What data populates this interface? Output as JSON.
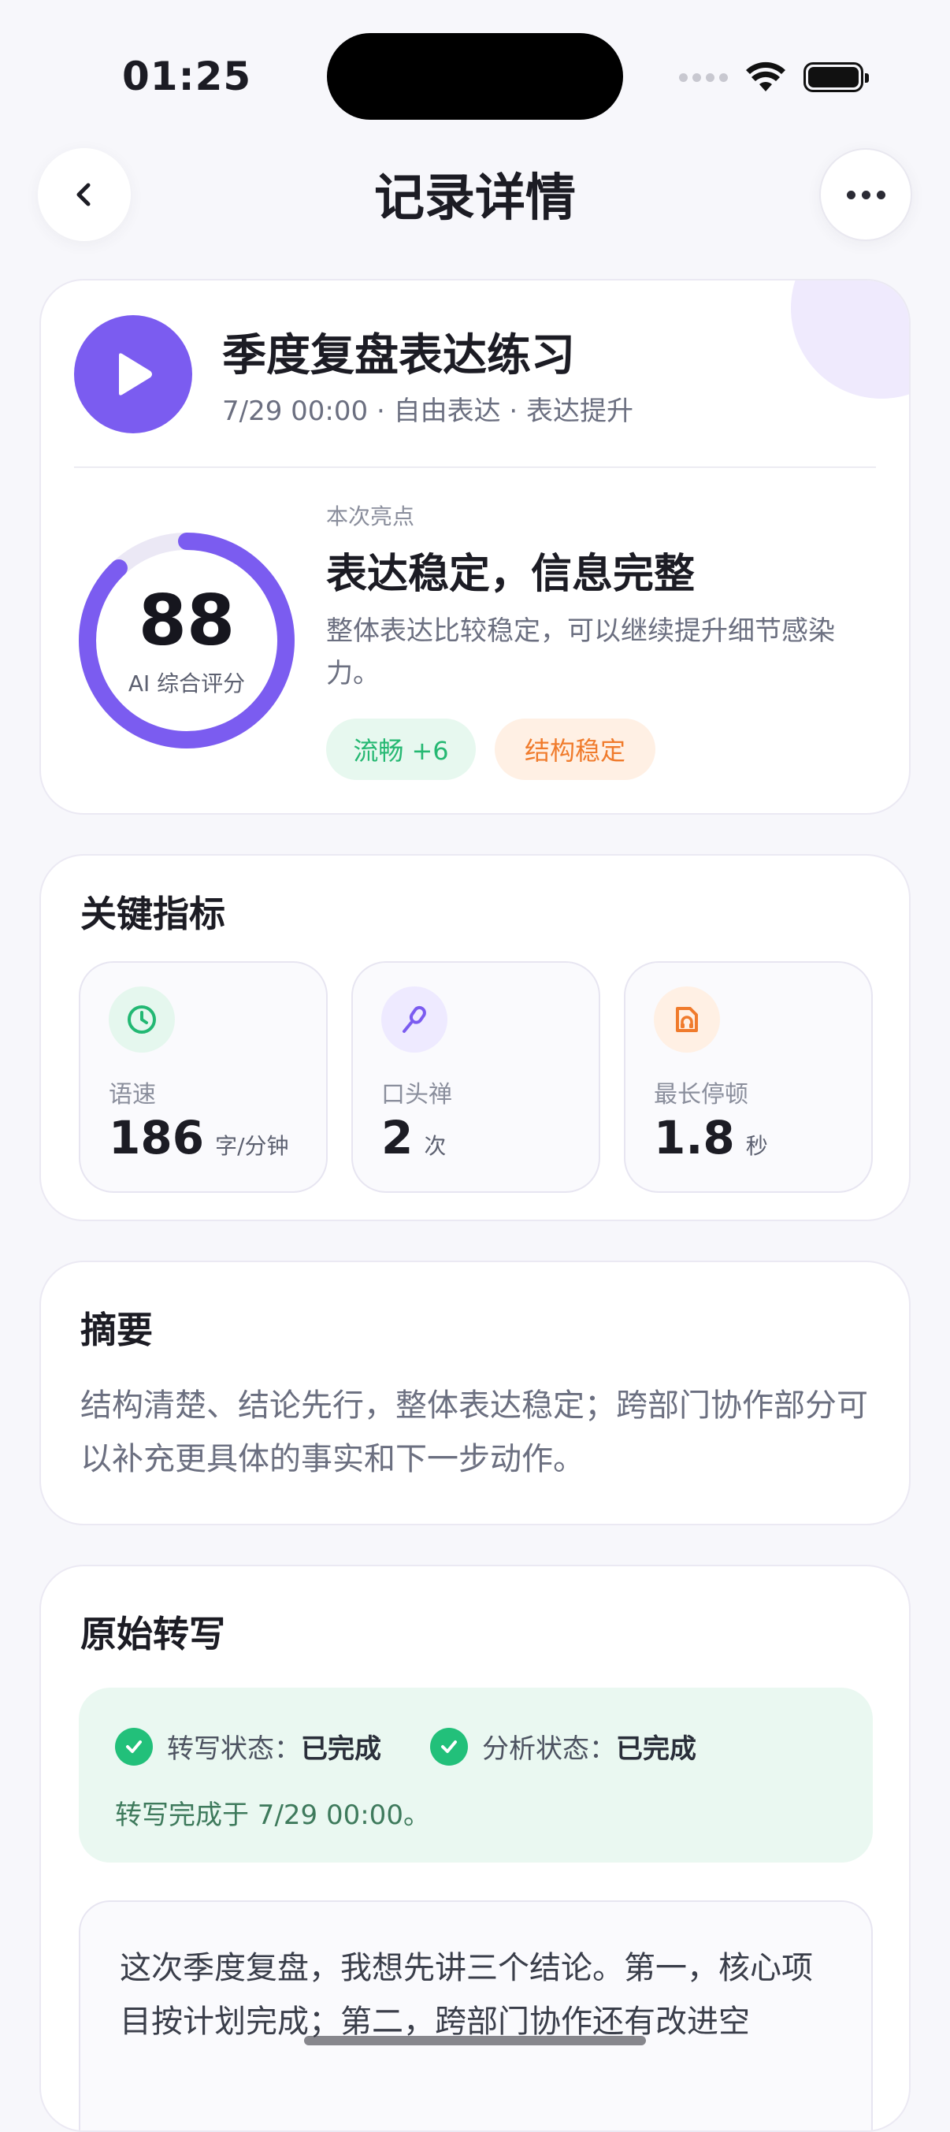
{
  "status_bar": {
    "time": "01:25"
  },
  "nav": {
    "title": "记录详情",
    "back_icon": "chevron-left-icon",
    "more_icon": "more-horizontal-icon"
  },
  "record": {
    "title": "季度复盘表达练习",
    "meta": "7/29 00:00 · 自由表达 · 表达提升",
    "score": "88",
    "score_percent": 88,
    "score_caption": "AI 综合评分",
    "highlight_label": "本次亮点",
    "highlight_title": "表达稳定，信息完整",
    "highlight_desc": "整体表达比较稳定，可以继续提升细节感染力。",
    "tags": [
      {
        "label": "流畅 +6",
        "color": "#25b872"
      },
      {
        "label": "结构稳定",
        "color": "#f07b2c"
      }
    ]
  },
  "metrics": {
    "title": "关键指标",
    "items": [
      {
        "icon": "clock-icon",
        "label": "语速",
        "value": "186",
        "unit": "字/分钟"
      },
      {
        "icon": "microphone-icon",
        "label": "口头禅",
        "value": "2",
        "unit": "次"
      },
      {
        "icon": "audio-file-icon",
        "label": "最长停顿",
        "value": "1.8",
        "unit": "秒"
      }
    ]
  },
  "summary": {
    "title": "摘要",
    "text": "结构清楚、结论先行，整体表达稳定；跨部门协作部分可以补充更具体的事实和下一步动作。"
  },
  "transcript": {
    "title": "原始转写",
    "transcribe_status_label": "转写状态：",
    "transcribe_status_value": "已完成",
    "analysis_status_label": "分析状态：",
    "analysis_status_value": "已完成",
    "completed_text": "转写完成于 7/29 00:00。",
    "text": "这次季度复盘，我想先讲三个结论。第一，核心项目按计划完成；第二，跨部门协作还有改进空"
  },
  "colors": {
    "accent": "#7b5cf0",
    "green": "#22c07a",
    "orange": "#f07b2c"
  }
}
